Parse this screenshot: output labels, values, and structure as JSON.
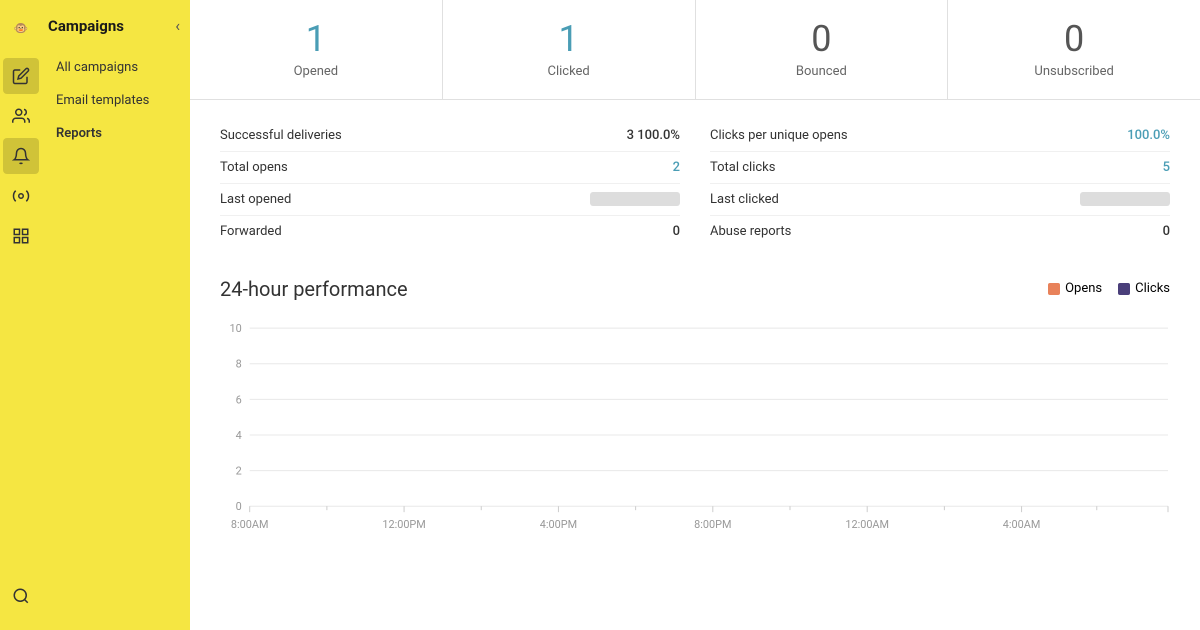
{
  "app": {
    "logo_alt": "Mailchimp",
    "sidebar_title": "Campaigns",
    "collapse_icon": "‹"
  },
  "left_icons": [
    {
      "name": "mailchimp-logo-icon",
      "symbol": "🐒",
      "active": false
    },
    {
      "name": "edit-icon",
      "symbol": "✏️",
      "active": false
    },
    {
      "name": "audience-icon",
      "symbol": "👥",
      "active": false
    },
    {
      "name": "campaigns-icon",
      "symbol": "📣",
      "active": true
    },
    {
      "name": "automations-icon",
      "symbol": "⚡",
      "active": false
    },
    {
      "name": "content-icon",
      "symbol": "▦",
      "active": false
    },
    {
      "name": "search-icon",
      "symbol": "🔍",
      "active": false
    }
  ],
  "sidebar": {
    "title": "Campaigns",
    "nav_items": [
      {
        "label": "All campaigns",
        "active": false
      },
      {
        "label": "Email templates",
        "active": false
      },
      {
        "label": "Reports",
        "active": true
      }
    ]
  },
  "stats": [
    {
      "number": "1",
      "label": "Opened",
      "blue": true
    },
    {
      "number": "1",
      "label": "Clicked",
      "blue": true
    },
    {
      "number": "0",
      "label": "Bounced",
      "blue": false
    },
    {
      "number": "0",
      "label": "Unsubscribed",
      "blue": false
    }
  ],
  "left_metrics": [
    {
      "label": "Successful deliveries",
      "value": "3 100.0%",
      "blue": false,
      "placeholder": false
    },
    {
      "label": "Total opens",
      "value": "2",
      "blue": true,
      "placeholder": false
    },
    {
      "label": "Last opened",
      "value": "",
      "blue": false,
      "placeholder": true
    },
    {
      "label": "Forwarded",
      "value": "0",
      "blue": false,
      "placeholder": false
    }
  ],
  "right_metrics": [
    {
      "label": "Clicks per unique opens",
      "value": "100.0%",
      "blue": true,
      "placeholder": false
    },
    {
      "label": "Total clicks",
      "value": "5",
      "blue": true,
      "placeholder": false
    },
    {
      "label": "Last clicked",
      "value": "",
      "blue": false,
      "placeholder": true
    },
    {
      "label": "Abuse reports",
      "value": "0",
      "blue": false,
      "placeholder": false
    }
  ],
  "chart": {
    "title": "24-hour performance",
    "legend": [
      {
        "label": "Opens",
        "color": "#e8825a"
      },
      {
        "label": "Clicks",
        "color": "#4a3f7a"
      }
    ],
    "y_labels": [
      "10",
      "8",
      "6",
      "4",
      "2",
      "0"
    ],
    "x_labels": [
      "8:00AM",
      "12:00PM",
      "4:00PM",
      "8:00PM",
      "12:00AM",
      "4:00AM"
    ],
    "colors": {
      "opens": "#e8825a",
      "clicks": "#4a3f7a"
    }
  }
}
